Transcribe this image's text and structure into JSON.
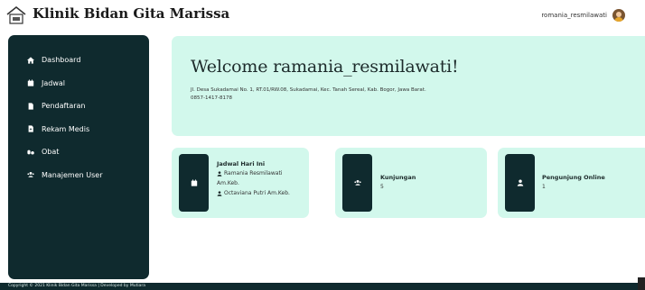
{
  "header": {
    "brand": "Klinik Bidan Gita Marissa",
    "username": "romania_resmilawati",
    "logo_icon": "clinic-house-icon",
    "avatar_icon": "user-avatar-icon"
  },
  "sidebar": {
    "items": [
      {
        "label": "Dashboard",
        "icon": "home-icon"
      },
      {
        "label": "Jadwal",
        "icon": "calendar-icon"
      },
      {
        "label": "Pendaftaran",
        "icon": "file-icon"
      },
      {
        "label": "Rekam Medis",
        "icon": "file-medical-icon"
      },
      {
        "label": "Obat",
        "icon": "pills-icon"
      },
      {
        "label": "Manajemen User",
        "icon": "users-icon"
      }
    ]
  },
  "welcome": {
    "heading": "Welcome ramania_resmilawati!",
    "address": "Jl. Desa Sukadamai No. 1, RT.01/RW.08, Sukadamai, Kec. Tanah Sereal, Kab. Bogor, Jawa Barat.",
    "phone": "0857-1417-8178"
  },
  "cards": {
    "jadwal": {
      "title": "Jadwal Hari Ini",
      "entries": [
        "Ramania Resmilawati",
        "Am.Keb.",
        "Octaviana Putri Am.Keb."
      ]
    },
    "kunjungan": {
      "title": "Kunjungan",
      "value": "5"
    },
    "online": {
      "title": "Pengunjung Online",
      "value": "1"
    }
  },
  "footer": {
    "text": "Copyright © 2021 Klinik Bidan Gita Marissa | Developed by Mutiara"
  },
  "colors": {
    "sidebar_bg": "#0f2a2e",
    "panel_bg": "#d2f8ec",
    "text_dark": "#1d2b2b"
  }
}
